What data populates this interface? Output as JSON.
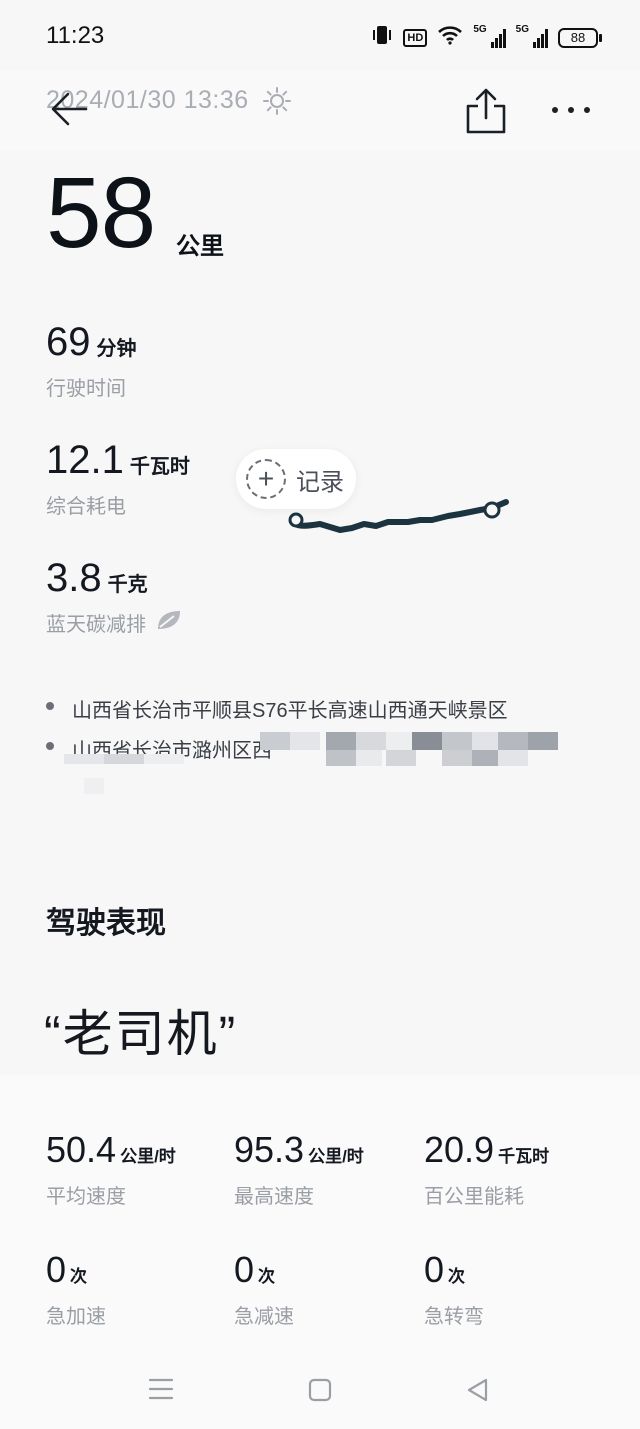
{
  "status_bar": {
    "time": "11:23",
    "hd_badge": "HD",
    "network_5g_1": "5G",
    "network_5g_2": "5G",
    "battery": "88"
  },
  "header": {
    "datetime": "2024/01/30 13:36"
  },
  "trip": {
    "distance_value": "58",
    "distance_unit": "公里",
    "duration_value": "69",
    "duration_unit": "分钟",
    "duration_label": "行驶时间",
    "energy_value": "12.1",
    "energy_unit": "千瓦时",
    "energy_label": "综合耗电",
    "carbon_value": "3.8",
    "carbon_unit": "千克",
    "carbon_label": "蓝天碳减排"
  },
  "record_button": {
    "label": "记录"
  },
  "addresses": [
    "山西省长治市平顺县S76平长高速山西通天峡景区",
    "山西省长治市潞州区西"
  ],
  "driving": {
    "section_title": "驾驶表现",
    "nickname": "“老司机”",
    "metrics": [
      {
        "value": "50.4",
        "unit": "公里/时",
        "label": "平均速度"
      },
      {
        "value": "95.3",
        "unit": "公里/时",
        "label": "最高速度"
      },
      {
        "value": "20.9",
        "unit": "千瓦时",
        "label": "百公里能耗"
      },
      {
        "value": "0",
        "unit": "次",
        "label": "急加速"
      },
      {
        "value": "0",
        "unit": "次",
        "label": "急减速"
      },
      {
        "value": "0",
        "unit": "次",
        "label": "急转弯"
      }
    ]
  },
  "colors": {
    "route": "#1c3340",
    "accent_text": "#141820",
    "muted_text": "#9a9ea5"
  },
  "icons": {
    "back": "back-arrow-icon",
    "share": "share-icon",
    "more": "more-icon",
    "weather": "sun-icon",
    "leaf": "leaf-icon"
  }
}
